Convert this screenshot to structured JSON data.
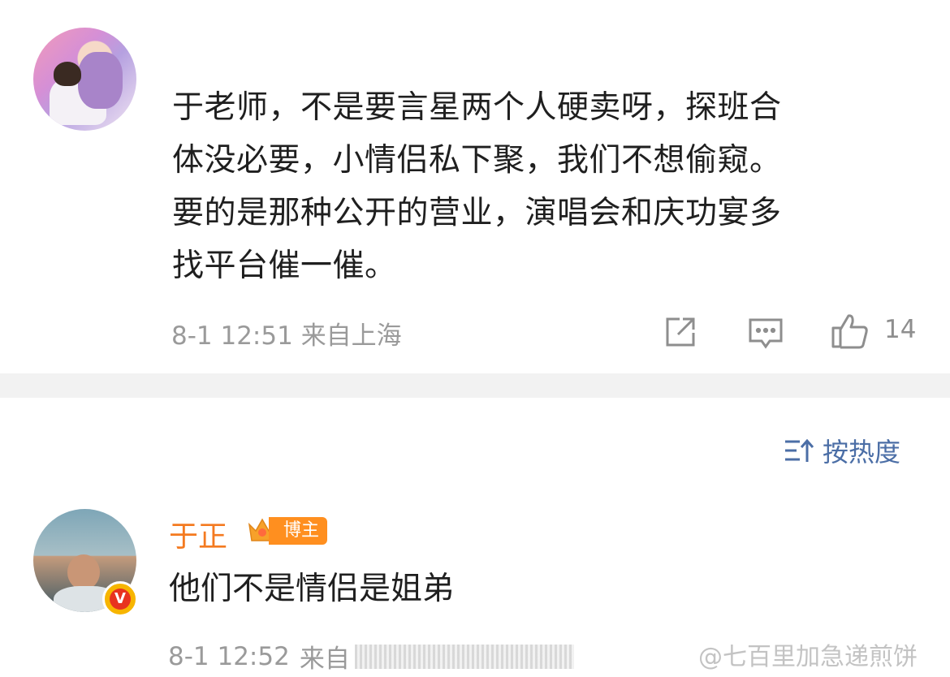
{
  "post": {
    "lines": [
      "于老师，不是要言星两个人硬卖呀，探班合",
      "体没必要，小情侣私下聚，我们不想偷窥。",
      "要的是那种公开的营业，演唱会和庆功宴多",
      "找平台催一催。"
    ],
    "date": "8-1 12:51",
    "location": "来自上海",
    "like_count": "14",
    "icons": [
      "share-icon",
      "comment-icon",
      "thumbs-up-icon"
    ]
  },
  "sort": {
    "label": "按热度",
    "icon": "sort-icon"
  },
  "reply": {
    "name": "于正",
    "badge": "博主",
    "text": "他们不是情侣是姐弟",
    "date": "8-1 12:52",
    "location_partial": "来自",
    "verified_mark": "V"
  },
  "watermark": "@七百里加急递煎饼",
  "colors": {
    "name_orange": "#f47a20",
    "sort_blue": "#4b6ea6",
    "badge_orange": "#ff8f1f",
    "meta_gray": "#9a9a9a",
    "separator": "#f2f2f2"
  }
}
